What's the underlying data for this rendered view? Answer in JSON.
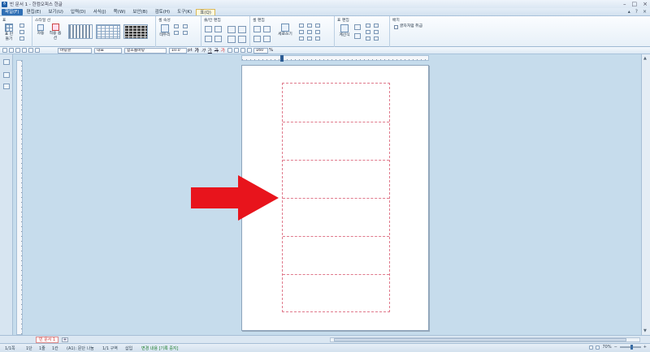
{
  "window": {
    "title": "빈 문서 1 - 한컴오피스 한글",
    "minimize": "–",
    "maximize": "□",
    "close": "×"
  },
  "menu": {
    "items": [
      {
        "label": "파일(F)",
        "state": "active"
      },
      {
        "label": "편집(E)"
      },
      {
        "label": "보기(U)"
      },
      {
        "label": "입력(D)"
      },
      {
        "label": "서식(J)"
      },
      {
        "label": "쪽(W)"
      },
      {
        "label": "보안(B)"
      },
      {
        "label": "검토(H)"
      },
      {
        "label": "도구(K)"
      },
      {
        "label": "표(Q)",
        "state": "tab"
      }
    ],
    "right_controls": [
      "▴",
      "?",
      "×"
    ]
  },
  "ribbon": {
    "groups": [
      {
        "title": "표",
        "buttons": [
          "표 만들기"
        ]
      },
      {
        "title": "스타일 선",
        "buttons": [
          "자동",
          "적용 옵션"
        ]
      },
      {
        "title": "셀 속성",
        "buttons": [
          "테두리"
        ]
      },
      {
        "title": "줄/칸 편집",
        "buttons": []
      },
      {
        "title": "셀 편집",
        "buttons": [
          "세로쓰기"
        ]
      },
      {
        "title": "표 편집",
        "buttons": [
          "계산식"
        ]
      },
      {
        "title": "배치",
        "buttons": [
          "글자처럼 취급"
        ]
      }
    ]
  },
  "format_toolbar": {
    "style": "바탕글",
    "font_lang": "대표",
    "font": "함초롬바탕",
    "size": "10.0",
    "size_unit": "pt",
    "bold": "가",
    "italic": "가",
    "underline": "가",
    "strike": "가",
    "color": "가",
    "line_spacing": "160",
    "line_spacing_unit": "%"
  },
  "document": {
    "table_rows": 6,
    "tab_label": "빈 문서 1"
  },
  "colors": {
    "arrow": "#e8141c",
    "table_border": "#e07a8c",
    "menu_active": "#2f6fb5"
  },
  "status": {
    "page": "1/1쪽",
    "section": "1단",
    "line": "1줄",
    "col": "1칸",
    "cell": "(A1): 문단 나눔",
    "zone": "1/1 구역",
    "mode": "삽입",
    "change": "변경 내용 [기록 중지]",
    "zoom": "70%"
  }
}
